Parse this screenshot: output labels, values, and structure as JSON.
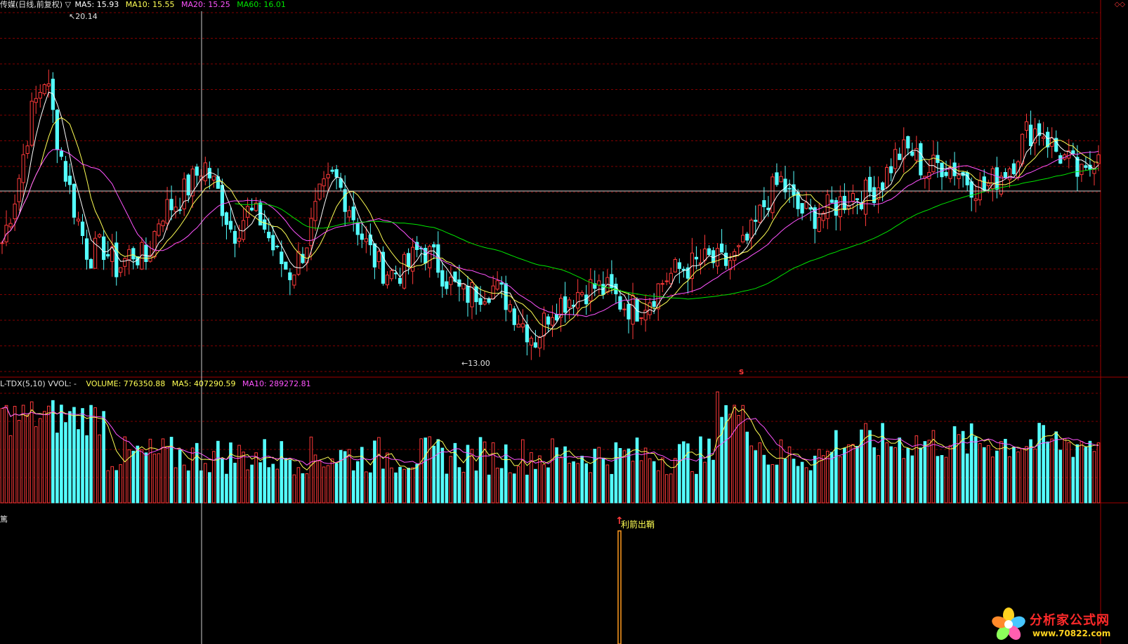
{
  "price_header": {
    "title": "传媒(日线,前复权) ▽",
    "ma5": "MA5: 15.93",
    "ma10": "MA10: 15.55",
    "ma20": "MA20: 15.25",
    "ma60": "MA60: 16.01"
  },
  "top_right_icons": "◇◇",
  "volume_header": {
    "name": "L-TDX(5,10)  VVOL: -",
    "volume": "VOLUME: 776350.88",
    "ma5": "MA5: 407290.59",
    "ma10": "MA10: 289272.81"
  },
  "indicator_header": {
    "name": "篤"
  },
  "signal": {
    "label": "利箭出鞘",
    "arrow": "↑"
  },
  "price_markers": {
    "high": "20.14",
    "low": "13.00"
  },
  "red_marker": "S",
  "watermark": {
    "name": "分析家公式网",
    "url": "www.70822.com"
  },
  "colors": {
    "up": "#ff3a3a",
    "down": "#54ffff",
    "ma5": "#ffffff",
    "ma10": "#ffff54",
    "ma20": "#ff54ff",
    "ma60": "#00e600",
    "grid": "#800000",
    "panel_border": "#a00000"
  },
  "chart_data": {
    "type": "candlestick",
    "y_range": [
      12.5,
      20.5
    ],
    "price_high": 20.14,
    "price_low": 13.0,
    "close": [
      15.4,
      16.6,
      18.3,
      19.2,
      17.5,
      16.2,
      15.1,
      15.3,
      14.8,
      15.2,
      15.0,
      16.1,
      16.3,
      16.7,
      17.2,
      16.5,
      15.6,
      16.1,
      15.9,
      15.1,
      14.7,
      15.3,
      16.4,
      16.9,
      16.3,
      15.5,
      14.9,
      14.7,
      14.8,
      15.3,
      15.0,
      14.5,
      14.2,
      14.3,
      14.4,
      14.1,
      13.6,
      13.2,
      13.9,
      14.1,
      14.3,
      14.4,
      14.3,
      14.0,
      13.9,
      14.2,
      14.6,
      14.8,
      14.9,
      15.0,
      14.9,
      15.1,
      15.6,
      16.4,
      16.8,
      16.2,
      16.0,
      16.1,
      16.3,
      16.5,
      16.5,
      16.8,
      17.4,
      17.5,
      17.0,
      17.2,
      17.1,
      16.8,
      16.6,
      16.9,
      17.2,
      17.9,
      18.0,
      17.5,
      17.2,
      16.8,
      17.6
    ],
    "ma60_last": 16.01,
    "ma5_last": 15.93,
    "ma10_last": 15.55,
    "ma20_last": 15.25,
    "volume_last": 776350.88,
    "volume_ma5_last": 407290.59,
    "volume_ma10_last": 289272.81
  }
}
